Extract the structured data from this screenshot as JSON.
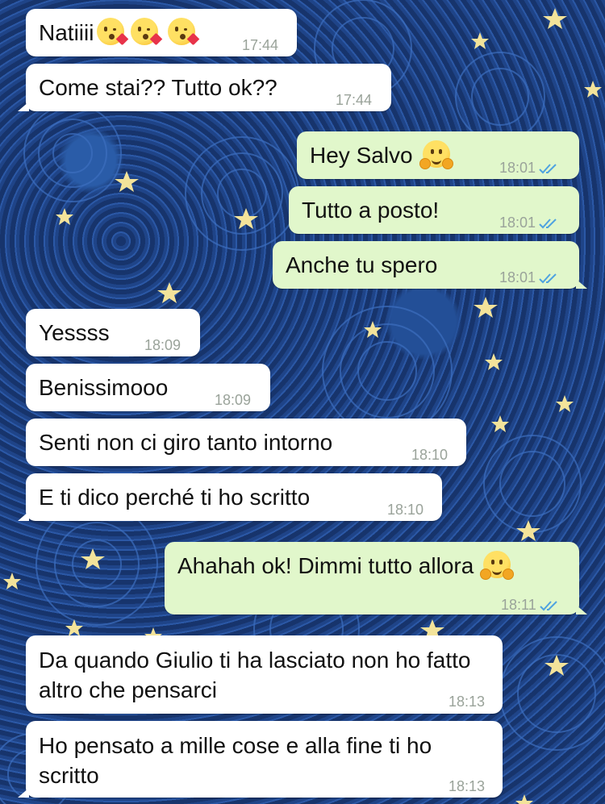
{
  "chat": {
    "messages": [
      {
        "id": "m1",
        "dir": "in",
        "text": "Natiiii",
        "time": "17:44",
        "emoji": [
          "kissing-heart-emoji",
          "kissing-heart-emoji",
          "kissing-heart-emoji"
        ]
      },
      {
        "id": "m2",
        "dir": "in",
        "text": "Come stai?? Tutto ok??",
        "time": "17:44"
      },
      {
        "id": "m3",
        "dir": "out",
        "text": "Hey Salvo",
        "time": "18:01",
        "emoji": [
          "hugging-face-emoji"
        ],
        "status": "read"
      },
      {
        "id": "m4",
        "dir": "out",
        "text": "Tutto a posto!",
        "time": "18:01",
        "status": "read"
      },
      {
        "id": "m5",
        "dir": "out",
        "text": "Anche tu spero",
        "time": "18:01",
        "status": "read"
      },
      {
        "id": "m6",
        "dir": "in",
        "text": "Yessss",
        "time": "18:09"
      },
      {
        "id": "m7",
        "dir": "in",
        "text": "Benissimooo",
        "time": "18:09"
      },
      {
        "id": "m8",
        "dir": "in",
        "text": "Senti non ci giro tanto intorno",
        "time": "18:10"
      },
      {
        "id": "m9",
        "dir": "in",
        "text": "E ti dico perché ti ho scritto",
        "time": "18:10"
      },
      {
        "id": "m10",
        "dir": "out",
        "text": "Ahahah ok! Dimmi tutto allora",
        "time": "18:11",
        "emoji": [
          "hugging-face-emoji"
        ],
        "status": "read"
      },
      {
        "id": "m11",
        "dir": "in",
        "text": "Da quando Giulio ti ha lasciato non ho fatto altro che pensarci",
        "time": "18:13"
      },
      {
        "id": "m12",
        "dir": "in",
        "text": "Ho pensato a mille cose e alla fine ti ho scritto",
        "time": "18:13"
      }
    ]
  },
  "colors": {
    "incoming_bubble": "#ffffff",
    "outgoing_bubble": "#e1f7cb",
    "read_check": "#4fa3e0",
    "wallpaper": "#1a3c7a"
  }
}
